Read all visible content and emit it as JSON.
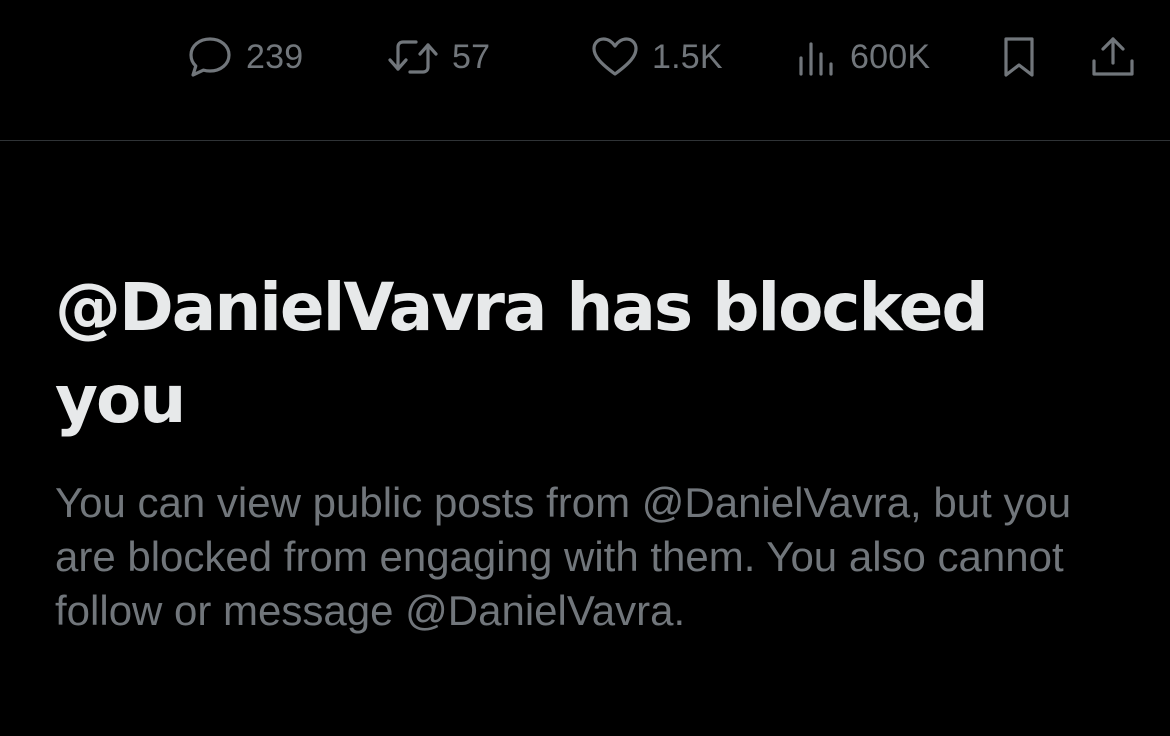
{
  "post_actions": {
    "reply": {
      "icon": "reply-bubble-icon",
      "count": "239"
    },
    "repost": {
      "icon": "repost-icon",
      "count": "57"
    },
    "like": {
      "icon": "heart-icon",
      "count": "1.5K"
    },
    "views": {
      "icon": "bar-chart-icon",
      "count": "600K"
    },
    "bookmark": {
      "icon": "bookmark-icon"
    },
    "share": {
      "icon": "share-upload-icon"
    }
  },
  "blocked_notice": {
    "title": "@DanielVavra has blocked you",
    "description": "You can view public posts from @DanielVavra, but you are blocked from engaging with them. You also cannot follow or message @DanielVavra."
  },
  "colors": {
    "background": "#000000",
    "primary_text": "#e7e9ea",
    "secondary_text": "#71767b",
    "divider": "#2f3336",
    "link_blue": "#1d9bf0"
  }
}
